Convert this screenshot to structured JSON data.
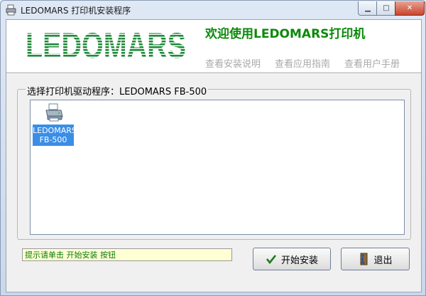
{
  "window": {
    "title": "LEDOMARS 打印机安装程序"
  },
  "header": {
    "logo_text": "LEDOMARS",
    "welcome": "欢迎使用LEDOMARS打印机",
    "links": [
      "查看安装说明",
      "查看应用指南",
      "查看用户手册"
    ],
    "link_color": "#a8a8a8",
    "welcome_color": "#0a8a0a"
  },
  "driver_group": {
    "label": "选择打印机驱动程序：LEDOMARS FB-500",
    "items": [
      {
        "label": "LEDOMARS\nFB-500",
        "selected": true,
        "icon": "printer-icon"
      }
    ]
  },
  "footer": {
    "hint": "提示请单击 开始安装 按钮",
    "install_label": "开始安装",
    "exit_label": "退出"
  }
}
